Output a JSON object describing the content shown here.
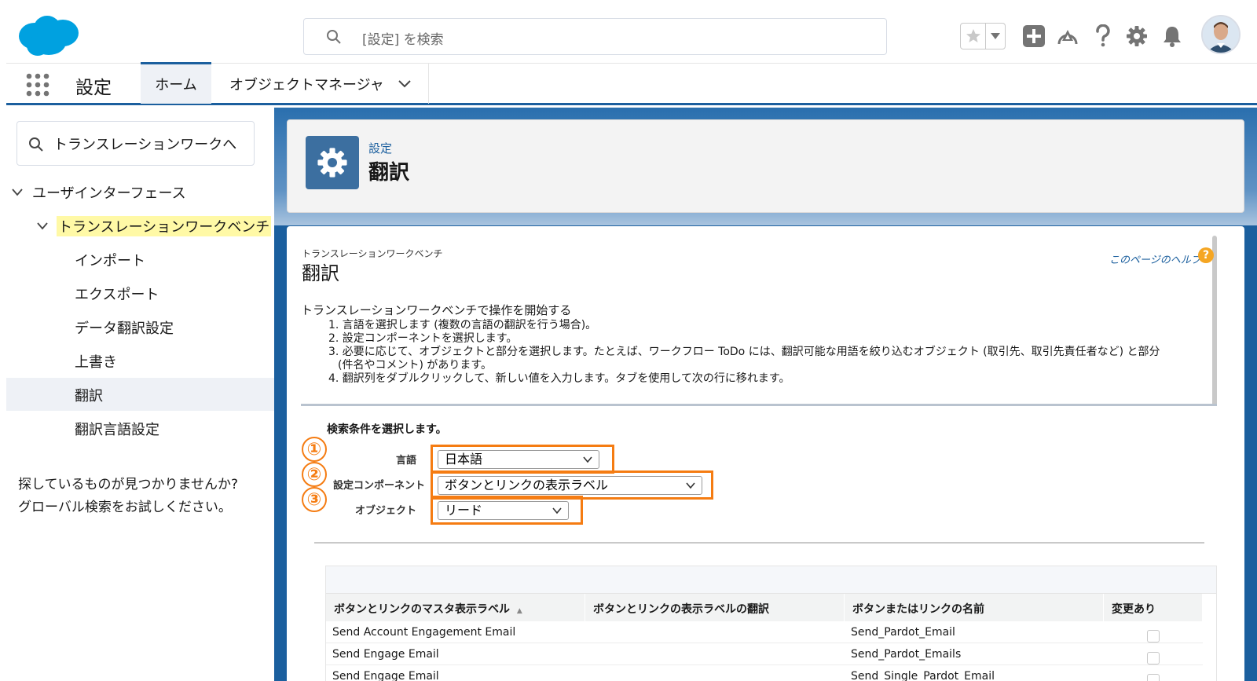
{
  "header": {
    "search_placeholder": "[設定] を検索"
  },
  "navbar": {
    "app_name": "設定",
    "tabs": [
      {
        "label": "ホーム"
      },
      {
        "label": "オブジェクトマネージャ"
      }
    ]
  },
  "sidebar": {
    "quickfind_value": "トランスレーションワークへ",
    "tree": [
      {
        "label": "ユーザインターフェース"
      },
      {
        "label": "トランスレーションワークベンチ"
      },
      {
        "label": "インポート"
      },
      {
        "label": "エクスポート"
      },
      {
        "label": "データ翻訳設定"
      },
      {
        "label": "上書き"
      },
      {
        "label": "翻訳"
      },
      {
        "label": "翻訳言語設定"
      }
    ],
    "note_line1": "探しているものが見つかりませんか?",
    "note_line2": "グローバル検索をお試しください。"
  },
  "page_header": {
    "breadcrumb": "設定",
    "title": "翻訳"
  },
  "content": {
    "small_title": "トランスレーションワークベンチ",
    "title": "翻訳",
    "help_link": "このページのヘルプ",
    "intro": "トランスレーションワークベンチで操作を開始する",
    "steps": [
      "1. 言語を選択します (複数の言語の翻訳を行う場合)。",
      "2. 設定コンポーネントを選択します。",
      "3. 必要に応じて、オブジェクトと部分を選択します。たとえば、ワークフロー ToDo には、翻訳可能な用語を絞り込むオブジェクト (取引先、取引先責任者など) と部分",
      "(件名やコメント) があります。",
      "4. 翻訳列をダブルクリックして、新しい値を入力します。タブを使用して次の行に移れます。"
    ]
  },
  "filters": {
    "heading": "検索条件を選択します。",
    "language_label": "言語",
    "language_value": "日本語",
    "component_label": "設定コンポーネント",
    "component_value": "ボタンとリンクの表示ラベル",
    "object_label": "オブジェクト",
    "object_value": "リード",
    "markers": [
      "①",
      "②",
      "③"
    ],
    "highlight_color": "#f57c12"
  },
  "grid": {
    "columns": [
      "ボタンとリンクのマスタ表示ラベル",
      "ボタンとリンクの表示ラベルの翻訳",
      "ボタンまたはリンクの名前",
      "変更あり"
    ],
    "rows": [
      {
        "master": "Send Account Engagement Email",
        "translation": "",
        "name": "Send_Pardot_Email",
        "changed": false
      },
      {
        "master": "Send Engage Email",
        "translation": "",
        "name": "Send_Pardot_Emails",
        "changed": false
      },
      {
        "master": "Send Engage Email",
        "translation": "",
        "name": "Send_Single_Pardot_Email",
        "changed": false
      }
    ]
  },
  "colors": {
    "brand": "#1b5f9e",
    "logo": "#00a1e0"
  }
}
